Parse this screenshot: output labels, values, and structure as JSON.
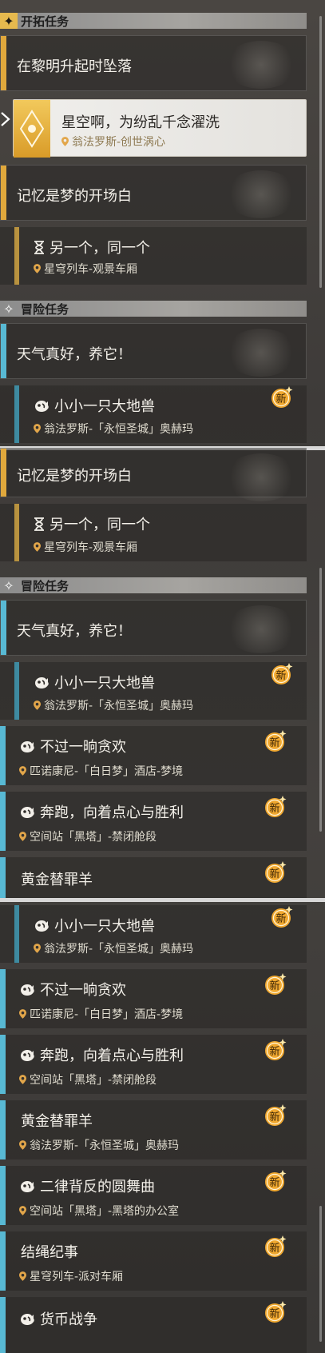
{
  "sections": {
    "trailblaze": "开拓任务",
    "adventure": "冒险任务"
  },
  "quests": {
    "dawn": "在黎明升起时坠落",
    "starry": {
      "title": "星空啊，为纷乱千念濯洗",
      "loc": "翁法罗斯-创世涡心"
    },
    "memory": "记忆是梦的开场白",
    "another": {
      "title": "另一个，同一个",
      "loc": "星穹列车-观景车厢"
    },
    "weather": "天气真好，养它！",
    "beast": {
      "title": "小小一只大地兽",
      "loc": "翁法罗斯-「永恒圣城」奥赫玛"
    },
    "feast": {
      "title": "不过一晌贪欢",
      "loc": "匹诺康尼-「白日梦」酒店-梦境"
    },
    "run": {
      "title": "奔跑，向着点心与胜利",
      "loc": "空间站「黑塔」-禁闭舱段"
    },
    "goat": {
      "title": "黄金替罪羊",
      "loc": "翁法罗斯-「永恒圣城」奥赫玛",
      "loc_clipped": "翁法罗斯-「永恒圣城」奥赫玛"
    },
    "waltz": {
      "title": "二律背反的圆舞曲",
      "loc": "空间站「黑塔」-黑塔的办公室"
    },
    "knot": {
      "title": "结绳纪事",
      "loc": "星穹列车-派对车厢"
    },
    "currency": {
      "title": "货币战争"
    }
  },
  "badge_text": "新",
  "colors": {
    "gold": "#e0a83c",
    "blue": "#58b9d4",
    "badge": "#f0a830"
  }
}
